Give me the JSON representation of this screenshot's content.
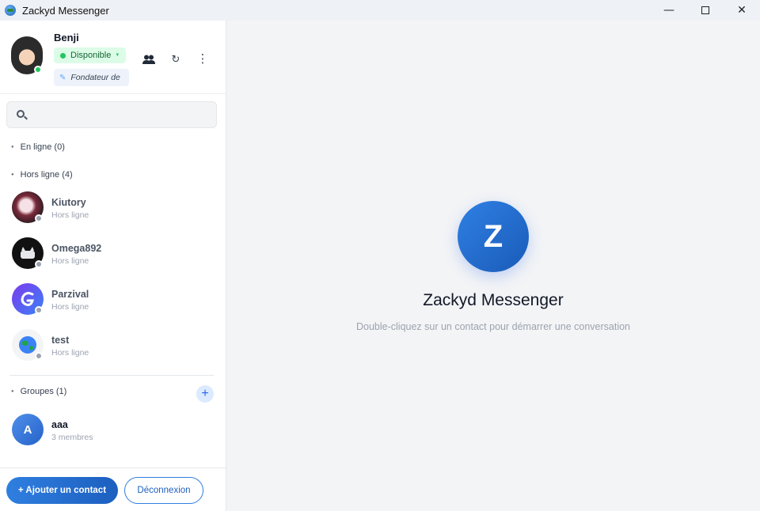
{
  "window": {
    "title": "Zackyd Messenger",
    "controls": {
      "minimize": "—",
      "close": "✕"
    }
  },
  "profile": {
    "name": "Benji",
    "status": "Disponible",
    "status_color": "#22c55e",
    "motto": "Fondateur de"
  },
  "search": {
    "placeholder": ""
  },
  "sections": {
    "online": "En ligne (0)",
    "offline": "Hors ligne (4)",
    "groups": "Groupes (1)"
  },
  "contacts": [
    {
      "name": "Kiutory",
      "status": "Hors ligne"
    },
    {
      "name": "Omega892",
      "status": "Hors ligne"
    },
    {
      "name": "Parzival",
      "status": "Hors ligne"
    },
    {
      "name": "test",
      "status": "Hors ligne"
    }
  ],
  "groups": [
    {
      "initial": "A",
      "name": "aaa",
      "members": "3 membres"
    }
  ],
  "buttons": {
    "add_contact": "+ Ajouter un contact",
    "logout": "Déconnexion",
    "add_group": "+"
  },
  "welcome": {
    "logo_letter": "Z",
    "title": "Zackyd Messenger",
    "subtitle": "Double-cliquez sur un contact pour démarrer une conversation"
  },
  "colors": {
    "accent": "#1f6fd6",
    "online": "#22c55e",
    "offline": "#9ca3af"
  }
}
